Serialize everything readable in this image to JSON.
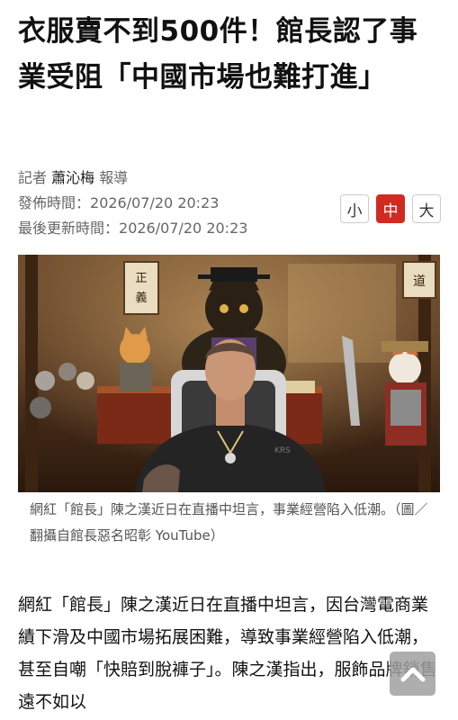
{
  "article": {
    "headline": "衣服賣不到500件！館長認了事業受阻「中國市場也難打進」",
    "author_prefix": "記者",
    "author_name": "蕭沁梅",
    "author_suffix": "報導",
    "published_label": "發佈時間：",
    "published_time": "2026/07/20 20:23",
    "updated_label": "最後更新時間：",
    "updated_time": "2026/07/20 20:23"
  },
  "font_size_controls": {
    "small": "小",
    "medium": "中",
    "large": "大",
    "selected": "medium"
  },
  "photo": {
    "sign_left": "正義",
    "sign_right": "道",
    "shirt_text": "KRS",
    "caption": "網紅「館長」陳之漢近日在直播中坦言，事業經營陷入低潮。（圖／翻攝自館長惡名昭彰 YouTube）"
  },
  "body": {
    "paragraph": "網紅「館長」陳之漢近日在直播中坦言，因台灣電商業績下滑及中國市場拓展困難，導致事業經營陷入低潮，甚至自嘲「快賠到脫褲子」。陳之漢指出，服飾品牌銷售遠不如以"
  },
  "colors": {
    "accent": "#d02b22",
    "meta_text": "#666666",
    "headline": "#111111"
  },
  "icons": {
    "back_to_top": "chevron-up-icon"
  }
}
